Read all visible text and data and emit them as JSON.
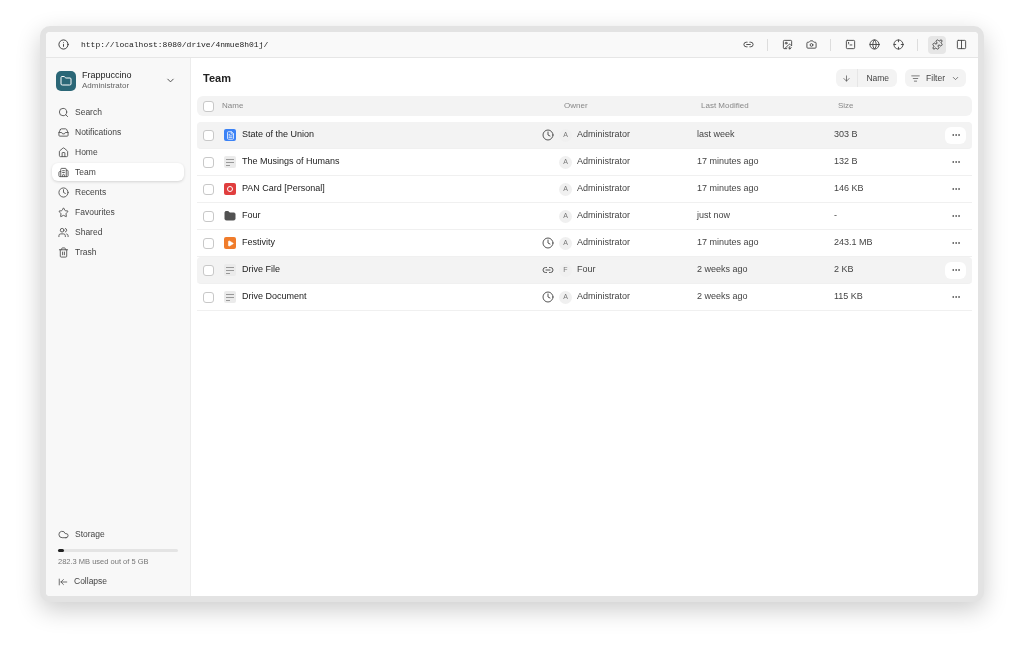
{
  "browser": {
    "url": "http://localhost:8080/drive/4nmue8h01j/",
    "toolbar": [
      {
        "selected": false
      },
      {
        "selected": false
      },
      {
        "selected": false
      },
      {
        "selected": false
      },
      {
        "selected": false
      },
      {
        "selected": false
      },
      {
        "selected": true
      },
      {
        "selected": false
      }
    ]
  },
  "sidebar": {
    "workspace": {
      "name": "Frappuccino",
      "role": "Administrator"
    },
    "items": [
      {
        "label": "Search",
        "kind": "search",
        "selected": false
      },
      {
        "label": "Notifications",
        "kind": "inbox",
        "selected": false
      },
      {
        "label": "Home",
        "kind": "home",
        "selected": false
      },
      {
        "label": "Team",
        "kind": "team",
        "selected": true
      },
      {
        "label": "Recents",
        "kind": "recents",
        "selected": false
      },
      {
        "label": "Favourites",
        "kind": "star",
        "selected": false
      },
      {
        "label": "Shared",
        "kind": "shared",
        "selected": false
      },
      {
        "label": "Trash",
        "kind": "trash",
        "selected": false
      }
    ],
    "storage": {
      "label": "Storage",
      "level": 0.05,
      "usage": "282.3 MB used out of 5 GB"
    },
    "collapse": "Collapse"
  },
  "header": {
    "title": "Team",
    "sort": "Name",
    "filter": "Filter"
  },
  "table": {
    "all_checked": false,
    "columns": [
      "Name",
      "Owner",
      "Last Modified",
      "Size"
    ],
    "rows": [
      {
        "name": "State of the Union",
        "kind": "document",
        "recent": true,
        "link": false,
        "owner_initial": "A",
        "owner": "Administrator",
        "modified": "last week",
        "size": "303 B",
        "selected": true,
        "checked": false
      },
      {
        "name": "The Musings of Humans",
        "kind": "text",
        "recent": false,
        "link": false,
        "owner_initial": "A",
        "owner": "Administrator",
        "modified": "17 minutes ago",
        "size": "132 B",
        "selected": false,
        "checked": false
      },
      {
        "name": "PAN Card [Personal]",
        "kind": "pdf",
        "recent": false,
        "link": false,
        "owner_initial": "A",
        "owner": "Administrator",
        "modified": "17 minutes ago",
        "size": "146 KB",
        "selected": false,
        "checked": false
      },
      {
        "name": "Four",
        "kind": "folder",
        "recent": false,
        "link": false,
        "owner_initial": "A",
        "owner": "Administrator",
        "modified": "just now",
        "size": "-",
        "selected": false,
        "checked": false
      },
      {
        "name": "Festivity",
        "kind": "video",
        "recent": true,
        "link": false,
        "owner_initial": "A",
        "owner": "Administrator",
        "modified": "17 minutes ago",
        "size": "243.1 MB",
        "selected": false,
        "checked": false
      },
      {
        "name": "Drive File",
        "kind": "text",
        "recent": false,
        "link": true,
        "owner_initial": "F",
        "owner": "Four",
        "modified": "2 weeks ago",
        "size": "2 KB",
        "selected": true,
        "checked": false
      },
      {
        "name": "Drive Document",
        "kind": "text",
        "recent": true,
        "link": false,
        "owner_initial": "A",
        "owner": "Administrator",
        "modified": "2 weeks ago",
        "size": "115 KB",
        "selected": false,
        "checked": false
      }
    ]
  }
}
